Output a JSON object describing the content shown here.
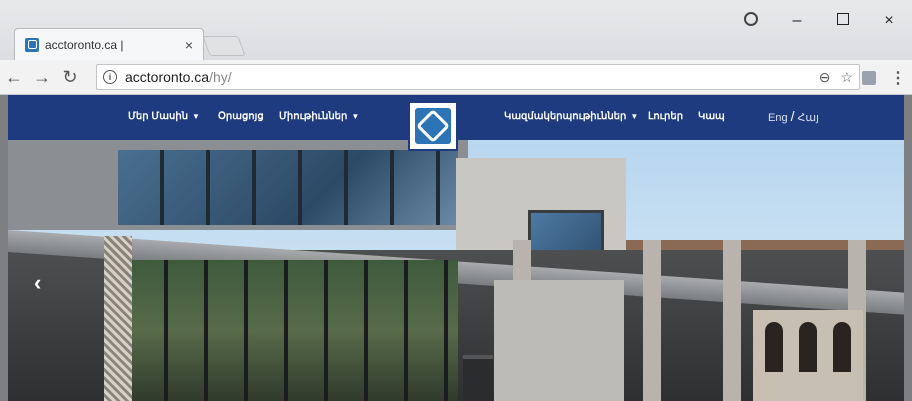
{
  "browser": {
    "tab": {
      "title": "acctoronto.ca |",
      "close": "×"
    },
    "window_controls": {
      "minimize": "–",
      "close": "×"
    },
    "address_bar": {
      "host": "acctoronto.ca",
      "path": "/hy/"
    }
  },
  "site": {
    "nav": {
      "left_items": [
        {
          "label": "Մեր Մասին",
          "has_dropdown": true
        },
        {
          "label": "Օրացոյց",
          "has_dropdown": false
        },
        {
          "label": "Միութիւններ",
          "has_dropdown": true
        }
      ],
      "right_items": [
        {
          "label": "Կազմակերպութիւններ",
          "has_dropdown": true
        },
        {
          "label": "Լուրեր",
          "has_dropdown": false
        },
        {
          "label": "Կապ",
          "has_dropdown": false
        }
      ],
      "lang_en": "Eng",
      "lang_sep": "/",
      "lang_hy": "Հայ"
    },
    "carousel": {
      "prev_icon": "chevron-left-icon"
    }
  },
  "colors": {
    "nav_bg": "#1d3b7e",
    "accent": "#2d74b6"
  }
}
